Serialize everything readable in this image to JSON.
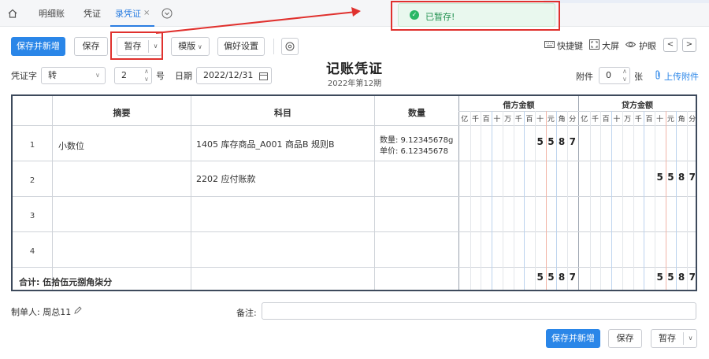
{
  "tabs": {
    "items": [
      "明细账",
      "凭证",
      "录凭证"
    ],
    "close": "×"
  },
  "toast": {
    "text": "已暂存!",
    "icon": "check-circle-icon",
    "color": "#2ab765"
  },
  "toolbar": {
    "save_new": "保存并新增",
    "save": "保存",
    "temp_save": "暂存",
    "template": "模版",
    "preferences": "偏好设置",
    "shortcuts": "快捷键",
    "fullscreen": "大屏",
    "eye_care": "护眼",
    "prev": "<",
    "next": ">"
  },
  "voucher": {
    "title": "记账凭证",
    "period": "2022年第12期",
    "word_label": "凭证字",
    "word_value": "转",
    "number_value": "2",
    "number_suffix": "号",
    "date_label": "日期",
    "date_value": "2022/12/31",
    "attach_label": "附件",
    "attach_value": "0",
    "attach_suffix": "张",
    "upload_label": "上传附件"
  },
  "table": {
    "headers": {
      "summary": "摘要",
      "subject": "科目",
      "quantity": "数量",
      "debit": "借方金额",
      "credit": "贷方金额"
    },
    "digit_units": [
      "亿",
      "千",
      "百",
      "十",
      "万",
      "千",
      "百",
      "十",
      "元",
      "角",
      "分"
    ],
    "rows": [
      {
        "no": "1",
        "summary": "小数位",
        "subject": "1405 库存商品_A001 商品B 规则B",
        "qty_line1": "数量: 9.12345678g",
        "qty_line2": "单价: 6.12345678",
        "debit": "5587",
        "credit": ""
      },
      {
        "no": "2",
        "summary": "",
        "subject": "2202 应付账款",
        "qty_line1": "",
        "qty_line2": "",
        "debit": "",
        "credit": "5587"
      },
      {
        "no": "3",
        "summary": "",
        "subject": "",
        "qty_line1": "",
        "qty_line2": "",
        "debit": "",
        "credit": ""
      },
      {
        "no": "4",
        "summary": "",
        "subject": "",
        "qty_line1": "",
        "qty_line2": "",
        "debit": "",
        "credit": ""
      }
    ],
    "total_label": "合计: 伍拾伍元捌角柒分",
    "total_debit": "5587",
    "total_credit": "5587"
  },
  "footer": {
    "maker_label": "制单人: 周总11",
    "remark_label": "备注:",
    "save_new": "保存并新增",
    "save": "保存",
    "temp_save": "暂存"
  },
  "colors": {
    "primary": "#2a86e8",
    "annotation_red": "#e0312e"
  }
}
